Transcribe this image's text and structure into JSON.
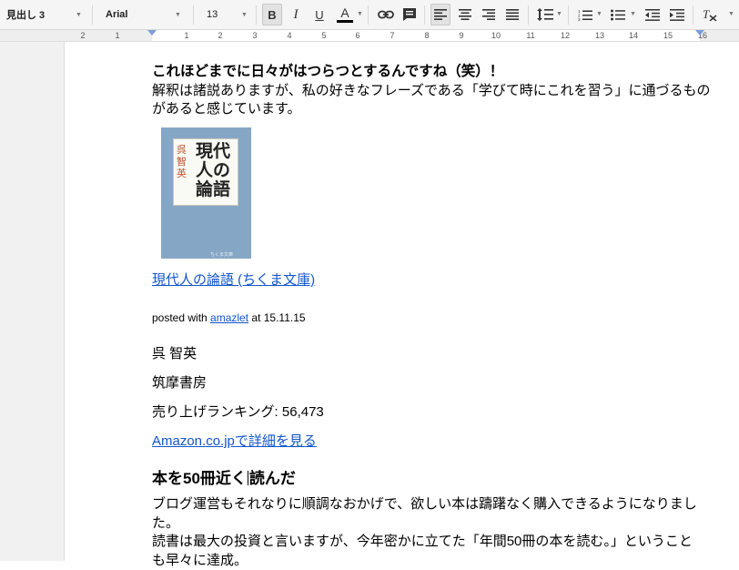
{
  "toolbar": {
    "style": "見出し 3",
    "font": "Arial",
    "size": "13",
    "bold": "B",
    "italic": "I",
    "underline": "U",
    "text_color": "A",
    "text_color_value": "#000000"
  },
  "ruler": {
    "numbers": [
      "2",
      "1",
      "1",
      "2",
      "3",
      "4",
      "5",
      "6",
      "7",
      "8",
      "9",
      "10",
      "11",
      "12",
      "13",
      "14",
      "15",
      "16"
    ]
  },
  "doc": {
    "bold_line": "これほどまでに日々がはつらつとするんですね（笑）！",
    "para1_line1": "解釈は諸説ありますが、私の好きなフレーズである「学びて時にこれを習う」に通づるもの",
    "para1_line2": "があると感じています。",
    "book_cover": {
      "title": "現代人の論語",
      "author": "呉智英",
      "publisher": "ちくま文庫"
    },
    "book_link": "現代人の論語 (ちくま文庫)",
    "posted_prefix": "posted with ",
    "posted_link": "amazlet",
    "posted_suffix": " at 15.11.15",
    "author": "呉 智英",
    "publisher": "筑摩書房",
    "ranking": "売り上げランキング: 56,473",
    "amazon_link": "Amazon.co.jpで詳細を見る",
    "heading_before_cursor": "本を50冊近く",
    "heading_after_cursor": "読んだ",
    "para2_line1": "ブログ運営もそれなりに順調なおかげで、欲しい本は躊躇なく購入できるようになりまし",
    "para2_line2": "た。",
    "para3_line1": "読書は最大の投資と言いますが、今年密かに立てた「年間50冊の本を読む。」ということ",
    "para3_line2": "も早々に達成。"
  },
  "colors": {
    "link": "#1155cc",
    "book_cover": "#86a6c6",
    "author_on_cover": "#c0502a"
  }
}
